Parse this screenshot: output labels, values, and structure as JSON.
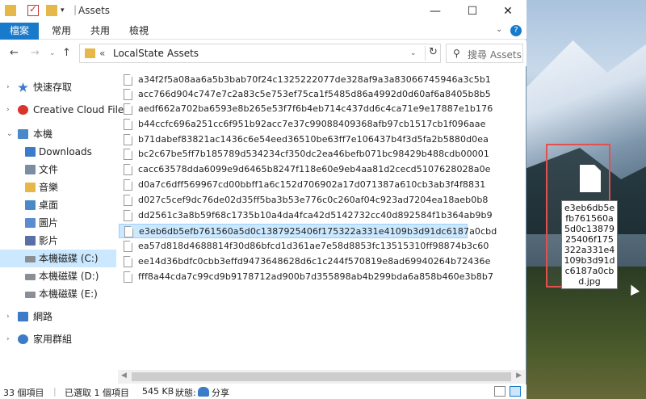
{
  "window": {
    "title": "Assets",
    "title_separator": "|",
    "controls": {
      "minimize": "—",
      "maximize": "☐",
      "close": "✕"
    }
  },
  "ribbon": {
    "tabs": [
      "檔案",
      "常用",
      "共用",
      "檢視"
    ],
    "collapse_glyph": "⌄",
    "help_glyph": "?"
  },
  "nav": {
    "back_glyph": "←",
    "forward_glyph": "→",
    "recent_glyph": "⌄",
    "up_glyph": "↑",
    "address": {
      "overflow": "«",
      "crumbs": [
        "LocalState",
        "Assets"
      ],
      "separator": "›"
    },
    "refresh_glyph": "↻",
    "search_placeholder": "搜尋 Assets",
    "search_glyph": "⚲"
  },
  "sidebar": {
    "items": [
      {
        "label": "快速存取",
        "icon": "star-icon",
        "color": "#3b7bc8"
      },
      {
        "label": "Creative Cloud Files",
        "icon": "creative-cloud-icon",
        "color": "#d9342b"
      },
      {
        "label": "本機",
        "icon": "computer-icon",
        "color": "#4a89c8"
      },
      {
        "label": "Downloads",
        "icon": "downloads-folder-icon",
        "color": "#3b7bc8"
      },
      {
        "label": "文件",
        "icon": "documents-folder-icon",
        "color": "#7b8da3"
      },
      {
        "label": "音樂",
        "icon": "music-folder-icon",
        "color": "#e6b84a"
      },
      {
        "label": "桌面",
        "icon": "desktop-folder-icon",
        "color": "#4a89c8"
      },
      {
        "label": "圖片",
        "icon": "pictures-folder-icon",
        "color": "#5a8ccf"
      },
      {
        "label": "影片",
        "icon": "videos-folder-icon",
        "color": "#5a6fa6"
      },
      {
        "label": "本機磁碟 (C:)",
        "icon": "drive-c-icon",
        "color": "#8a8f96",
        "selected": true
      },
      {
        "label": "本機磁碟 (D:)",
        "icon": "drive-d-icon",
        "color": "#8a8f96"
      },
      {
        "label": "本機磁碟 (E:)",
        "icon": "drive-e-icon",
        "color": "#8a8f96"
      },
      {
        "label": "網路",
        "icon": "network-icon",
        "color": "#3b7bc8"
      },
      {
        "label": "家用群組",
        "icon": "homegroup-icon",
        "color": "#3b7bc8"
      }
    ]
  },
  "files": [
    {
      "name": "a34f2f5a08aa6a5b3bab70f24c1325222077de328af9a3a83066745946a3c5b1"
    },
    {
      "name": "acc766d904c747e7c2a83c5e753ef75ca1f5485d86a4992d0d60af6a8405b8b5"
    },
    {
      "name": "aedf662a702ba6593e8b265e53f7f6b4eb714c437dd6c4ca71e9e17887e1b176"
    },
    {
      "name": "b44ccfc696a251cc6f951b92acc7e37c99088409368afb97cb1517cb1f096aae"
    },
    {
      "name": "b71dabef83821ac1436c6e54eed36510be63ff7e106437b4f3d5fa2b5880d0ea"
    },
    {
      "name": "bc2c67be5ff7b185789d534234cf350dc2ea46befb071bc98429b488cdb00001"
    },
    {
      "name": "cacc63578dda6099e9d6465b8247f118e60e9eb4aa81d2cecd5107628028a0e"
    },
    {
      "name": "d0a7c6dff569967cd00bbff1a6c152d706902a17d071387a610cb3ab3f4f8831"
    },
    {
      "name": "d027c5cef9dc76de02d35ff5ba3b53e776c0c260af04c923ad7204ea18aeb0b8"
    },
    {
      "name": "dd2561c3a8b59f68c1735b10a4da4fca42d5142732cc40d892584f1b364ab9b9"
    },
    {
      "name": "e3eb6db5efb761560a5d0c1387925406f175322a331e4109b3d91dc6187a0cbd",
      "selected": true
    },
    {
      "name": "ea57d818d4688814f30d86bfcd1d361ae7e58d8853fc13515310ff98874b3c60"
    },
    {
      "name": "ee14d36bdfc0cbb3effd9473648628d6c1c244f570819e8ad69940264b72436e"
    },
    {
      "name": "fff8a44cda7c99cd9b9178712ad900b7d355898ab4b299bda6a858b460e3b8b7"
    }
  ],
  "status": {
    "item_count": "33 個項目",
    "selected": "已選取 1 個項目",
    "size": "545 KB",
    "state_label": "狀態:",
    "state_value": "分享"
  },
  "desktop": {
    "renaming_label": "e3eb6db5efb761560a5d0c1387925406f175322a331e4109b3d91dc6187a0cbd.jpg"
  }
}
